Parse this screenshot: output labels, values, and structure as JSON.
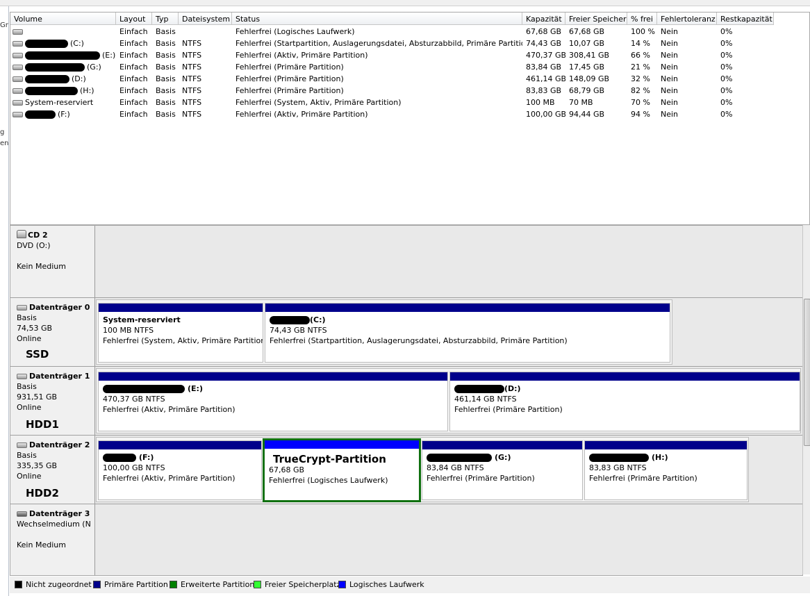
{
  "table": {
    "headers": [
      "Volume",
      "Layout",
      "Typ",
      "Dateisystem",
      "Status",
      "Kapazität",
      "Freier Speicher",
      "% frei",
      "Fehlertoleranz",
      "Restkapazität"
    ],
    "rows": [
      {
        "volume": "",
        "layout": "Einfach",
        "typ": "Basis",
        "fs": "",
        "status": "Fehlerfrei (Logisches Laufwerk)",
        "kap": "67,68 GB",
        "frei": "67,68 GB",
        "pct": "100 %",
        "ft": "Nein",
        "rest": "0%"
      },
      {
        "volume": "(C:)",
        "layout": "Einfach",
        "typ": "Basis",
        "fs": "NTFS",
        "status": "Fehlerfrei (Startpartition, Auslagerungsdatei, Absturzabbild, Primäre Partition)",
        "kap": "74,43 GB",
        "frei": "10,07 GB",
        "pct": "14 %",
        "ft": "Nein",
        "rest": "0%"
      },
      {
        "volume": "(E:)",
        "layout": "Einfach",
        "typ": "Basis",
        "fs": "NTFS",
        "status": "Fehlerfrei (Aktiv, Primäre Partition)",
        "kap": "470,37 GB",
        "frei": "308,41 GB",
        "pct": "66 %",
        "ft": "Nein",
        "rest": "0%"
      },
      {
        "volume": "(G:)",
        "layout": "Einfach",
        "typ": "Basis",
        "fs": "NTFS",
        "status": "Fehlerfrei (Primäre Partition)",
        "kap": "83,84 GB",
        "frei": "17,45 GB",
        "pct": "21 %",
        "ft": "Nein",
        "rest": "0%"
      },
      {
        "volume": "(D:)",
        "layout": "Einfach",
        "typ": "Basis",
        "fs": "NTFS",
        "status": "Fehlerfrei (Primäre Partition)",
        "kap": "461,14 GB",
        "frei": "148,09 GB",
        "pct": "32 %",
        "ft": "Nein",
        "rest": "0%"
      },
      {
        "volume": "(H:)",
        "layout": "Einfach",
        "typ": "Basis",
        "fs": "NTFS",
        "status": "Fehlerfrei (Primäre Partition)",
        "kap": "83,83 GB",
        "frei": "68,79 GB",
        "pct": "82 %",
        "ft": "Nein",
        "rest": "0%"
      },
      {
        "volume": "System-reserviert",
        "layout": "Einfach",
        "typ": "Basis",
        "fs": "NTFS",
        "status": "Fehlerfrei (System, Aktiv, Primäre Partition)",
        "kap": "100 MB",
        "frei": "70 MB",
        "pct": "70 %",
        "ft": "Nein",
        "rest": "0%"
      },
      {
        "volume": "(F:)",
        "layout": "Einfach",
        "typ": "Basis",
        "fs": "NTFS",
        "status": "Fehlerfrei (Aktiv, Primäre Partition)",
        "kap": "100,00 GB",
        "frei": "94,44 GB",
        "pct": "94 %",
        "ft": "Nein",
        "rest": "0%"
      }
    ]
  },
  "disks": {
    "cd2": {
      "name": "CD 2",
      "line1": "DVD (O:)",
      "line2": "",
      "line3": "Kein Medium"
    },
    "d0": {
      "name": "Datenträger 0",
      "line1": "Basis",
      "line2": "74,53 GB",
      "line3": "Online",
      "tag": "SSD",
      "parts": [
        {
          "title": "System-reserviert",
          "size": "100 MB NTFS",
          "status": "Fehlerfrei (System, Aktiv, Primäre Partition)"
        },
        {
          "title": "(C:)",
          "size": "74,43 GB NTFS",
          "status": "Fehlerfrei (Startpartition, Auslagerungsdatei, Absturzabbild, Primäre Partition)"
        }
      ]
    },
    "d1": {
      "name": "Datenträger 1",
      "line1": "Basis",
      "line2": "931,51 GB",
      "line3": "Online",
      "tag": "HDD1",
      "parts": [
        {
          "title": "(E:)",
          "size": "470,37 GB NTFS",
          "status": "Fehlerfrei (Aktiv, Primäre Partition)"
        },
        {
          "title": "(D:)",
          "size": "461,14 GB NTFS",
          "status": "Fehlerfrei (Primäre Partition)"
        }
      ]
    },
    "d2": {
      "name": "Datenträger 2",
      "line1": "Basis",
      "line2": "335,35 GB",
      "line3": "Online",
      "tag": "HDD2",
      "parts": [
        {
          "title": "(F:)",
          "size": "100,00 GB NTFS",
          "status": "Fehlerfrei (Aktiv, Primäre Partition)"
        },
        {
          "title": "TrueCrypt-Partition",
          "size": "67,68 GB",
          "status": "Fehlerfrei (Logisches Laufwerk)"
        },
        {
          "title": "(G:)",
          "size": "83,84 GB NTFS",
          "status": "Fehlerfrei (Primäre Partition)"
        },
        {
          "title": "(H:)",
          "size": "83,83 GB NTFS",
          "status": "Fehlerfrei (Primäre Partition)"
        }
      ]
    },
    "d3": {
      "name": "Datenträger 3",
      "line1": "Wechselmedium (N:",
      "line2": "",
      "line3": "Kein Medium"
    }
  },
  "legend": [
    {
      "label": "Nicht zugeordnet",
      "color": "#000000"
    },
    {
      "label": "Primäre Partition",
      "color": "#00008b"
    },
    {
      "label": "Erweiterte Partition",
      "color": "#008000"
    },
    {
      "label": "Freier Speicherplatz",
      "color": "#33ff33"
    },
    {
      "label": "Logisches Laufwerk",
      "color": "#0000ff"
    }
  ],
  "colors": {
    "primary_bar": "#00008b",
    "logical_bar": "#0000ff",
    "selection": "#107010"
  },
  "left_strip": [
    "g",
    "en",
    "Gr"
  ]
}
